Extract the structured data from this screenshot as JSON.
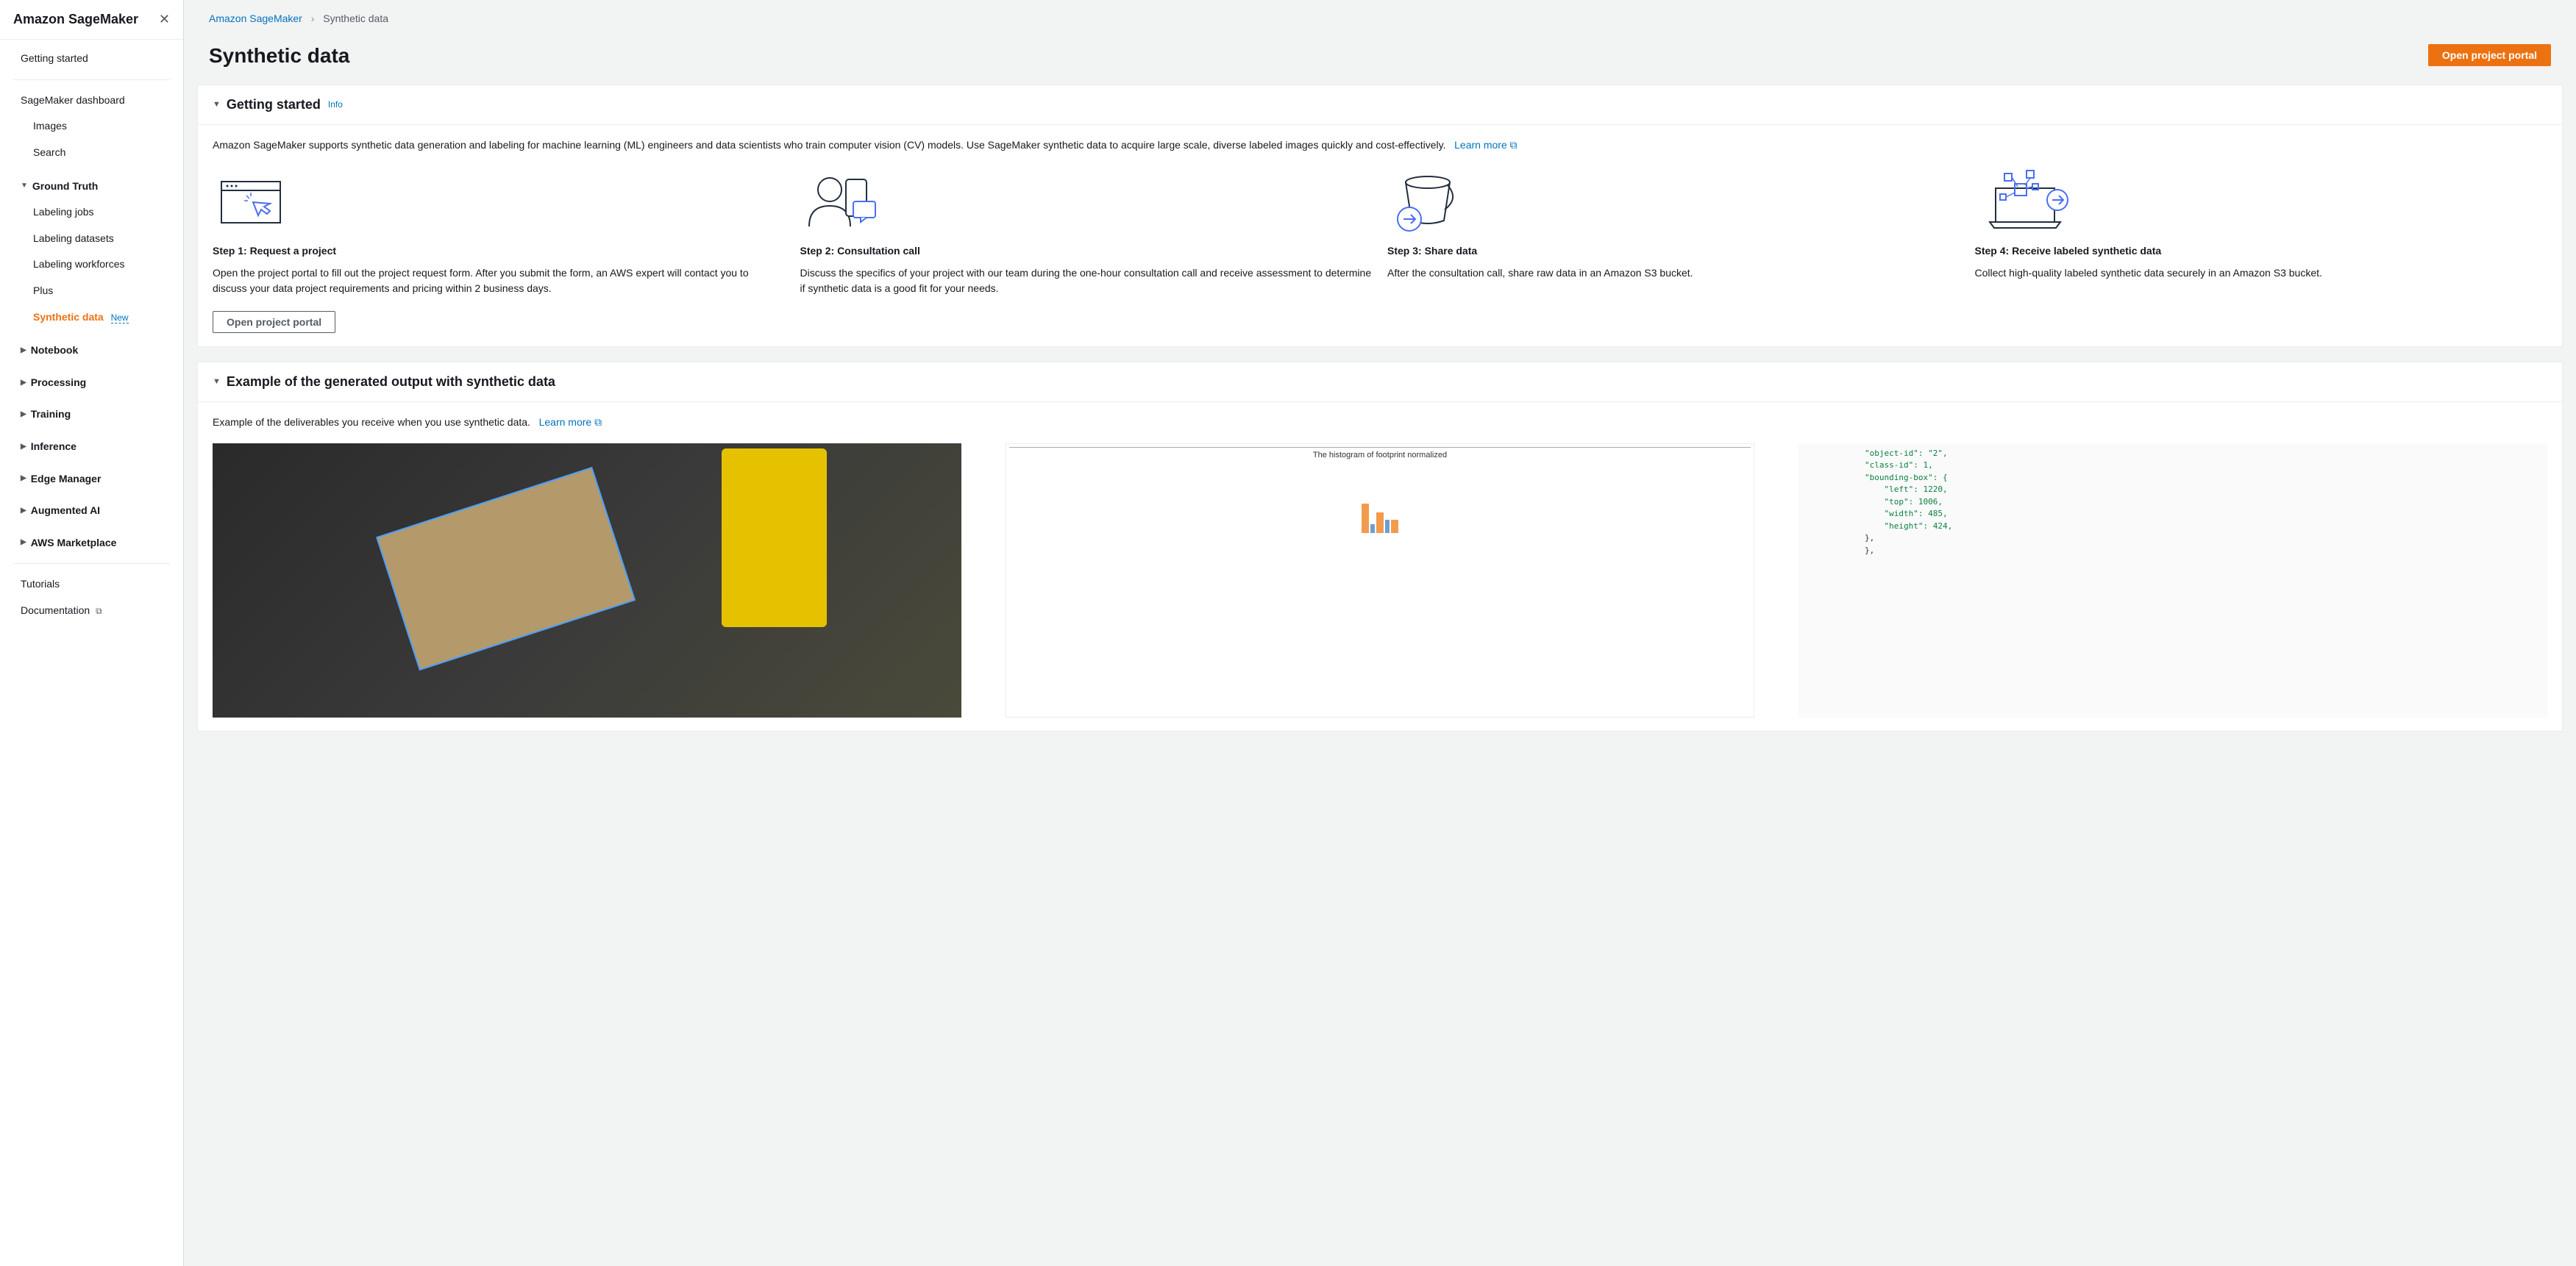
{
  "sidebar": {
    "title": "Amazon SageMaker",
    "getting_started": "Getting started",
    "dashboard": "SageMaker dashboard",
    "images": "Images",
    "search": "Search",
    "ground_truth": "Ground Truth",
    "labeling_jobs": "Labeling jobs",
    "labeling_datasets": "Labeling datasets",
    "labeling_workforces": "Labeling workforces",
    "plus": "Plus",
    "synthetic_data": "Synthetic data",
    "new_badge": "New",
    "notebook": "Notebook",
    "processing": "Processing",
    "training": "Training",
    "inference": "Inference",
    "edge_manager": "Edge Manager",
    "augmented_ai": "Augmented AI",
    "aws_marketplace": "AWS Marketplace",
    "tutorials": "Tutorials",
    "documentation": "Documentation"
  },
  "breadcrumb": {
    "root": "Amazon SageMaker",
    "current": "Synthetic data"
  },
  "page": {
    "title": "Synthetic data",
    "open_portal": "Open project portal"
  },
  "getting_started_panel": {
    "title": "Getting started",
    "info": "Info",
    "intro": "Amazon SageMaker supports synthetic data generation and labeling for machine learning (ML) engineers and data scientists who train computer vision (CV) models. Use SageMaker synthetic data to acquire large scale, diverse labeled images quickly and cost-effectively.",
    "learn_more": "Learn more",
    "steps": [
      {
        "title": "Step 1: Request a project",
        "desc": "Open the project portal to fill out the project request form. After you submit the form, an AWS expert will contact you to discuss your data project requirements and pricing within 2 business days."
      },
      {
        "title": "Step 2: Consultation call",
        "desc": "Discuss the specifics of your project with our team during the one-hour consultation call and receive assessment to determine if synthetic data is a good fit for your needs."
      },
      {
        "title": "Step 3: Share data",
        "desc": "After the consultation call, share raw data in an Amazon S3 bucket."
      },
      {
        "title": "Step 4: Receive labeled synthetic data",
        "desc": "Collect high-quality labeled synthetic data securely in an Amazon S3 bucket."
      }
    ],
    "open_portal_secondary": "Open project portal"
  },
  "example_panel": {
    "title": "Example of the generated output with synthetic data",
    "intro": "Example of the deliverables you receive when you use synthetic data.",
    "learn_more": "Learn more",
    "histogram_title": "The histogram of footprint normalized",
    "json_snippet": {
      "l1": "\"object-id\": \"2\",",
      "l2": "\"class-id\": 1,",
      "l3": "\"bounding-box\": {",
      "l4": "    \"left\": 1220,",
      "l5": "    \"top\": 1006,",
      "l6": "    \"width\": 485,",
      "l7": "    \"height\": 424,",
      "l8": "},",
      "l9": "},"
    }
  }
}
